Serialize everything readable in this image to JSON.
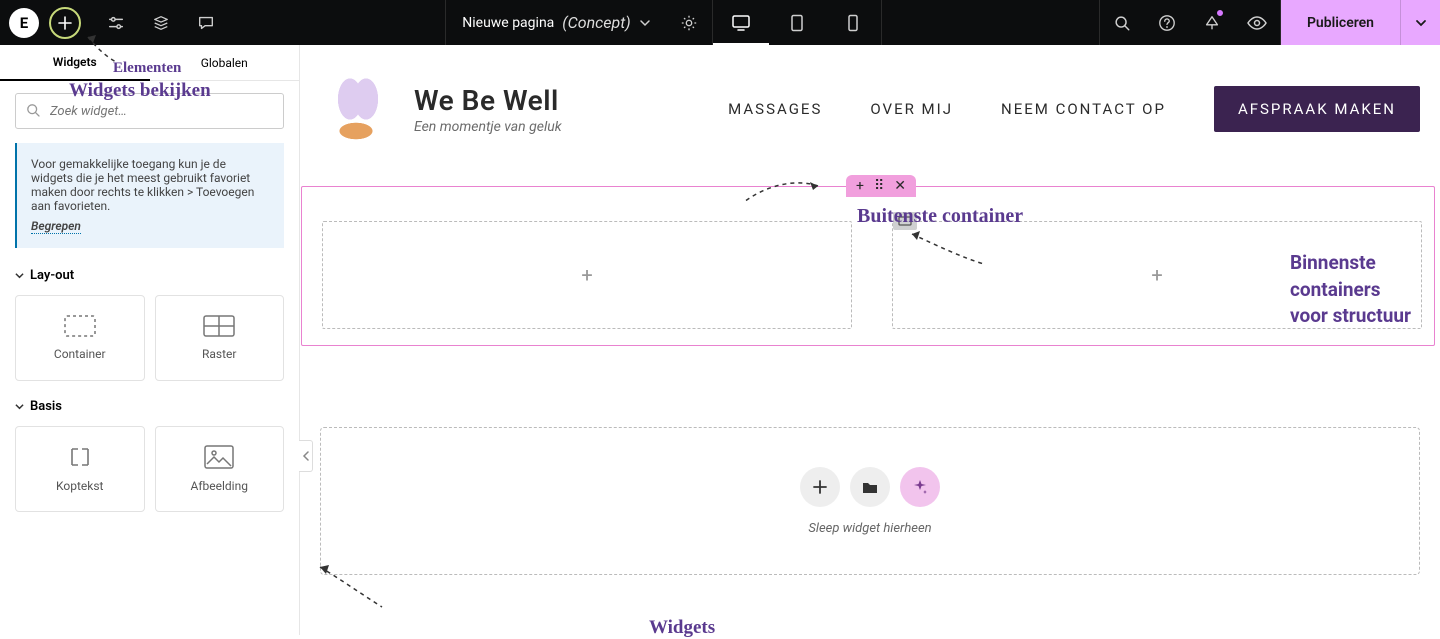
{
  "topbar": {
    "page_title": "Nieuwe pagina",
    "page_status": "(Concept)",
    "publish_label": "Publiceren"
  },
  "sidebar": {
    "tabs": {
      "widgets": "Widgets",
      "globals": "Globalen"
    },
    "search_placeholder": "Zoek widget…",
    "tip_text": "Voor gemakkelijke toegang kun je de widgets die je het meest gebruikt favoriet maken door rechts te klikken > Toevoegen aan favorieten.",
    "tip_dismiss": "Begrepen",
    "sections": {
      "layout": {
        "title": "Lay-out",
        "items": [
          "Container",
          "Raster"
        ]
      },
      "basic": {
        "title": "Basis",
        "items": [
          "Koptekst",
          "Afbeelding"
        ]
      }
    }
  },
  "canvas": {
    "brand": {
      "title": "We Be Well",
      "tagline": "Een momentje van geluk"
    },
    "nav": [
      "MASSAGES",
      "OVER MIJ",
      "NEEM CONTACT OP"
    ],
    "cta": "AFSPRAAK MAKEN",
    "drop_hint": "Sleep widget hierheen"
  },
  "annotations": {
    "elements": "Elementen",
    "view_widgets": "Widgets bekijken",
    "outer": "Buitenste container",
    "inner_l1": "Binnenste containers",
    "inner_l2": "voor structuur",
    "widgets": "Widgets"
  }
}
